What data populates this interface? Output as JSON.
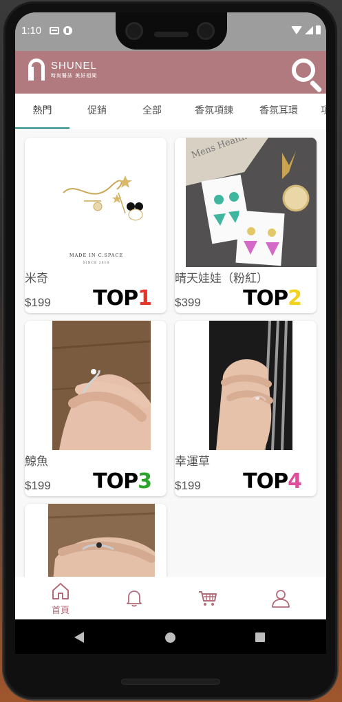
{
  "status": {
    "time": "1:10"
  },
  "header": {
    "brand": "SHUNEL",
    "tagline": "時尚醫誌 美好相聞",
    "search_icon": "search-icon"
  },
  "tabs": [
    {
      "label": "熱門",
      "active": true
    },
    {
      "label": "促銷"
    },
    {
      "label": "全部"
    },
    {
      "label": "香氛項鍊"
    },
    {
      "label": "香氛耳環"
    },
    {
      "label": "項"
    }
  ],
  "products": [
    {
      "name": "米奇",
      "price": "$199",
      "rank_word": "TOP",
      "rank_num": "1",
      "photo_caption": "MADE IN C.SPACE",
      "photo_sub": "SINCE 2010"
    },
    {
      "name": "晴天娃娃（粉紅）",
      "price": "$399",
      "rank_word": "TOP",
      "rank_num": "2",
      "photo_text": "Mens Health"
    },
    {
      "name": "鯨魚",
      "price": "$199",
      "rank_word": "TOP",
      "rank_num": "3"
    },
    {
      "name": "幸運草",
      "price": "$199",
      "rank_word": "TOP",
      "rank_num": "4"
    },
    {
      "name": "",
      "price": ""
    }
  ],
  "bottom_nav": [
    {
      "label": "首頁",
      "icon": "home-icon"
    },
    {
      "label": "",
      "icon": "bell-icon"
    },
    {
      "label": "",
      "icon": "cart-icon"
    },
    {
      "label": "",
      "icon": "user-icon"
    }
  ],
  "colors": {
    "header": "#b07a7e",
    "accent": "#b36a78",
    "tab_indicator": "#2a8c86",
    "top1": "#e8362a",
    "top2": "#f2d21c",
    "top3": "#2aa52a",
    "top4": "#e04d9c"
  }
}
